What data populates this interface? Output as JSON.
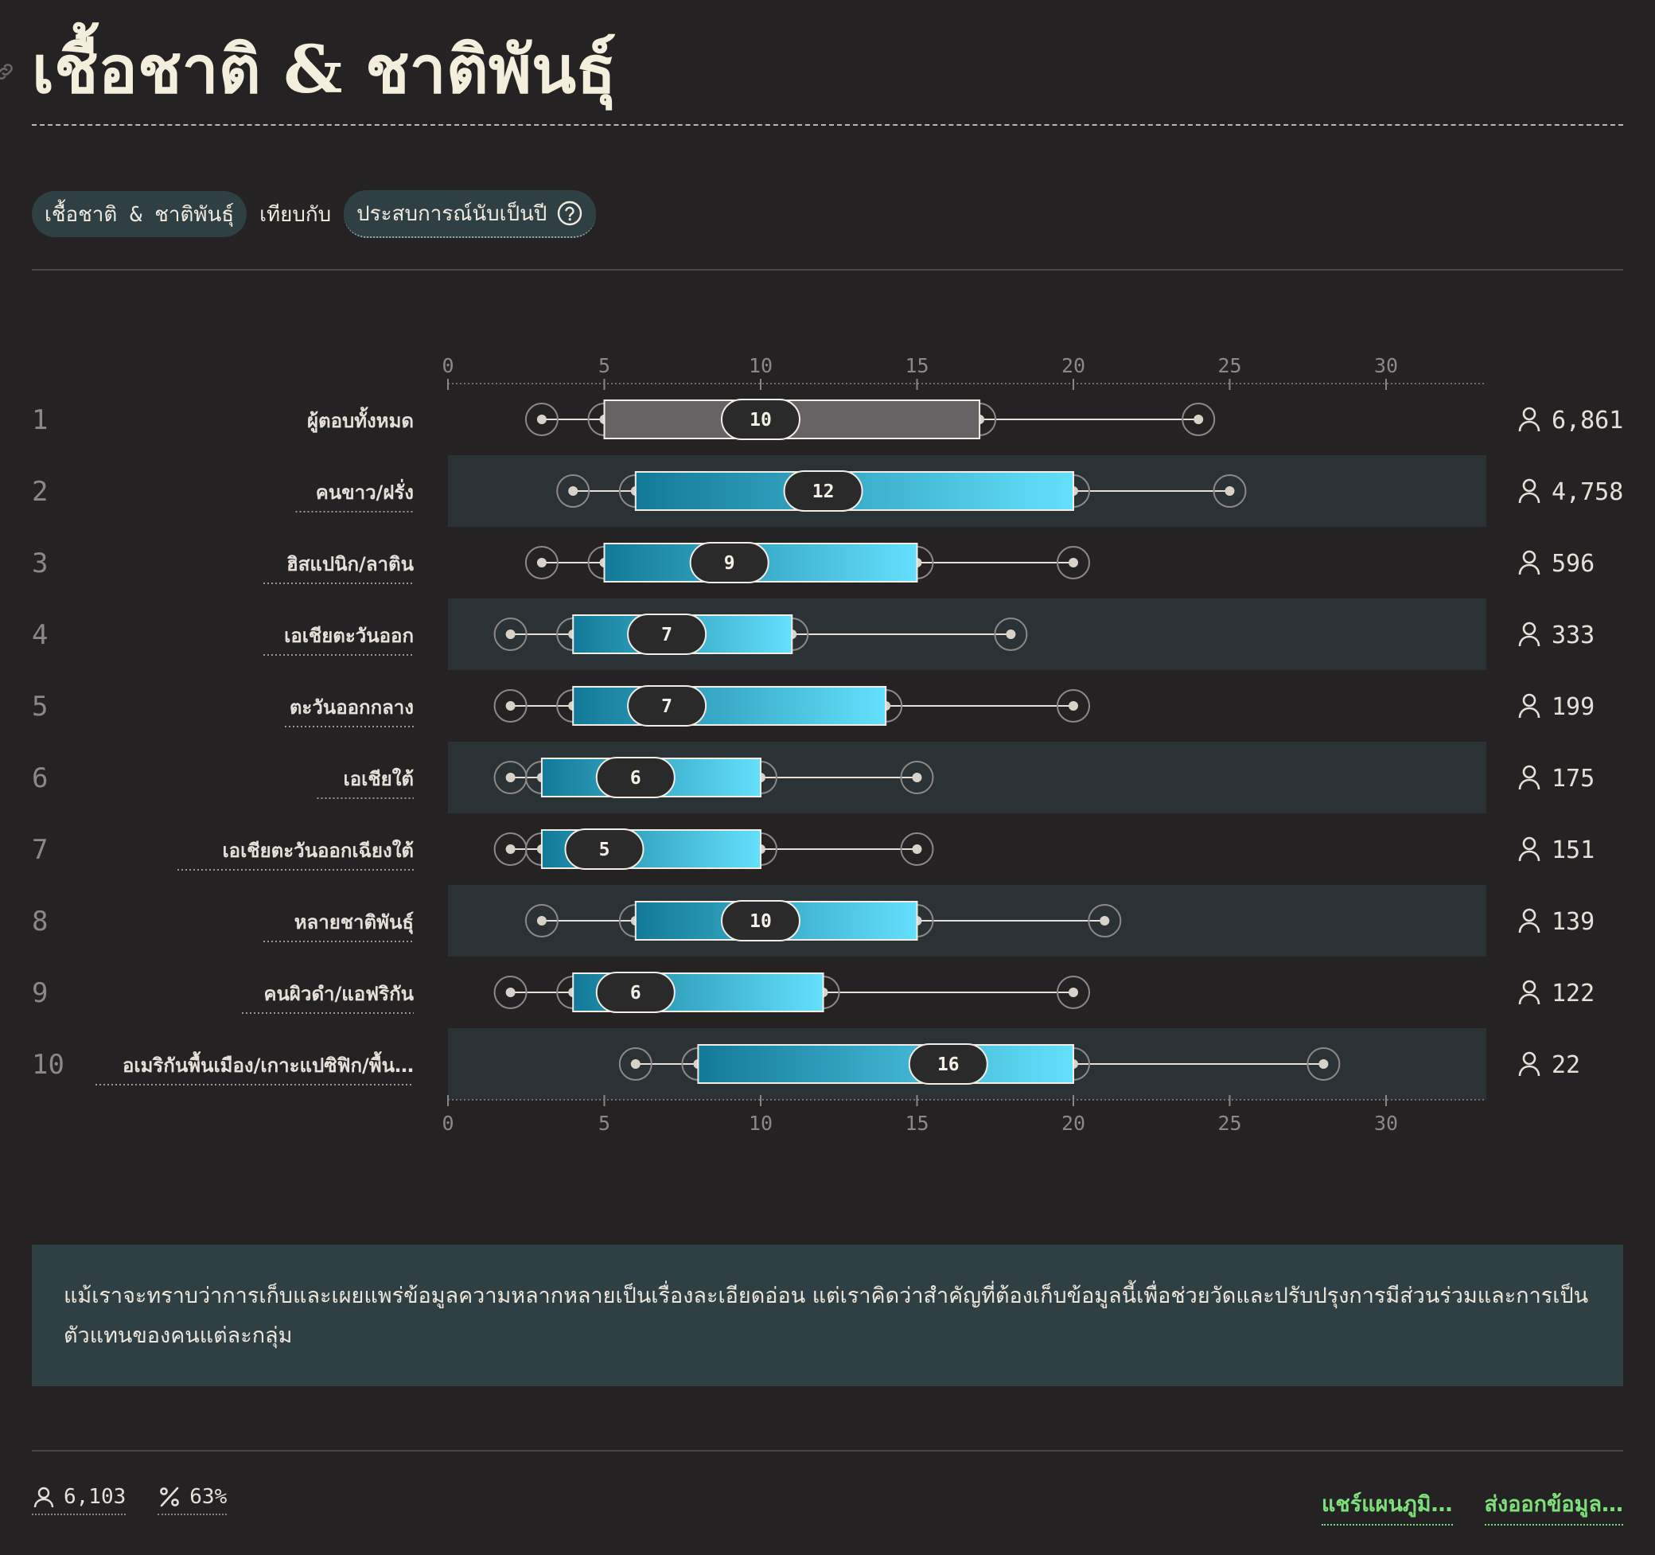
{
  "page": {
    "title": "เชื้อชาติ & ชาติพันธุ์",
    "selector": {
      "group_by": "เชื้อชาติ & ชาติพันธุ์",
      "vs_label": "เทียบกับ",
      "metric": "ประสบการณ์นับเป็นปี"
    },
    "note": "แม้เราจะทราบว่าการเก็บและเผยแพร่ข้อมูลความหลากหลายเป็นเรื่องละเอียดอ่อน แต่เราคิดว่าสำคัญที่ต้องเก็บข้อมูลนี้เพื่อช่วยวัดและปรับปรุงการมีส่วนร่วมและการเป็นตัวแทนของคนแต่ละกลุ่ม",
    "footer": {
      "respondents": "6,103",
      "percent": "63%",
      "share_label": "แชร์แผนภูมิ…",
      "export_label": "ส่งออกข้อมูล…"
    }
  },
  "colors": {
    "background": "#252223",
    "row_band": "#2b3235",
    "box_gradient_start": "#127a98",
    "box_gradient_end": "#64e0fc",
    "overall_box": "#676364",
    "median_pill": "#2b2a2b",
    "text": "#e6e0d8",
    "muted": "#8d8888",
    "accent_link": "#7ee07a",
    "note_bg": "#2f4045"
  },
  "chart_data": {
    "type": "boxplot",
    "x_ticks": [
      0,
      5,
      10,
      15,
      20,
      25,
      30
    ],
    "xlim": [
      0,
      33
    ],
    "rows": [
      {
        "rank": "1",
        "label": "ผู้ตอบทั้งหมด",
        "p10": 3,
        "q1": 5,
        "median": 10,
        "q3": 17,
        "p90": 24,
        "count": "6,861",
        "overall": true
      },
      {
        "rank": "2",
        "label": "คนขาว/ฝรั่ง",
        "p10": 4,
        "q1": 6,
        "median": 12,
        "q3": 20,
        "p90": 25,
        "count": "4,758"
      },
      {
        "rank": "3",
        "label": "ฮิสแปนิก/ลาติน",
        "p10": 3,
        "q1": 5,
        "median": 9,
        "q3": 15,
        "p90": 20,
        "count": "596"
      },
      {
        "rank": "4",
        "label": "เอเชียตะวันออก",
        "p10": 2,
        "q1": 4,
        "median": 7,
        "q3": 11,
        "p90": 18,
        "count": "333"
      },
      {
        "rank": "5",
        "label": "ตะวันออกกลาง",
        "p10": 2,
        "q1": 4,
        "median": 7,
        "q3": 14,
        "p90": 20,
        "count": "199"
      },
      {
        "rank": "6",
        "label": "เอเชียใต้",
        "p10": 2,
        "q1": 3,
        "median": 6,
        "q3": 10,
        "p90": 15,
        "count": "175"
      },
      {
        "rank": "7",
        "label": "เอเชียตะวันออกเฉียงใต้",
        "p10": 2,
        "q1": 3,
        "median": 5,
        "q3": 10,
        "p90": 15,
        "count": "151"
      },
      {
        "rank": "8",
        "label": "หลายชาติพันธุ์",
        "p10": 3,
        "q1": 6,
        "median": 10,
        "q3": 15,
        "p90": 21,
        "count": "139"
      },
      {
        "rank": "9",
        "label": "คนผิวดำ/แอฟริกัน",
        "p10": 2,
        "q1": 4,
        "median": 6,
        "q3": 12,
        "p90": 20,
        "count": "122"
      },
      {
        "rank": "10",
        "label": "อเมริกันพื้นเมือง/เกาะแปซิฟิก/พื้น…",
        "p10": 6,
        "q1": 8,
        "median": 16,
        "q3": 20,
        "p90": 28,
        "count": "22"
      }
    ]
  }
}
